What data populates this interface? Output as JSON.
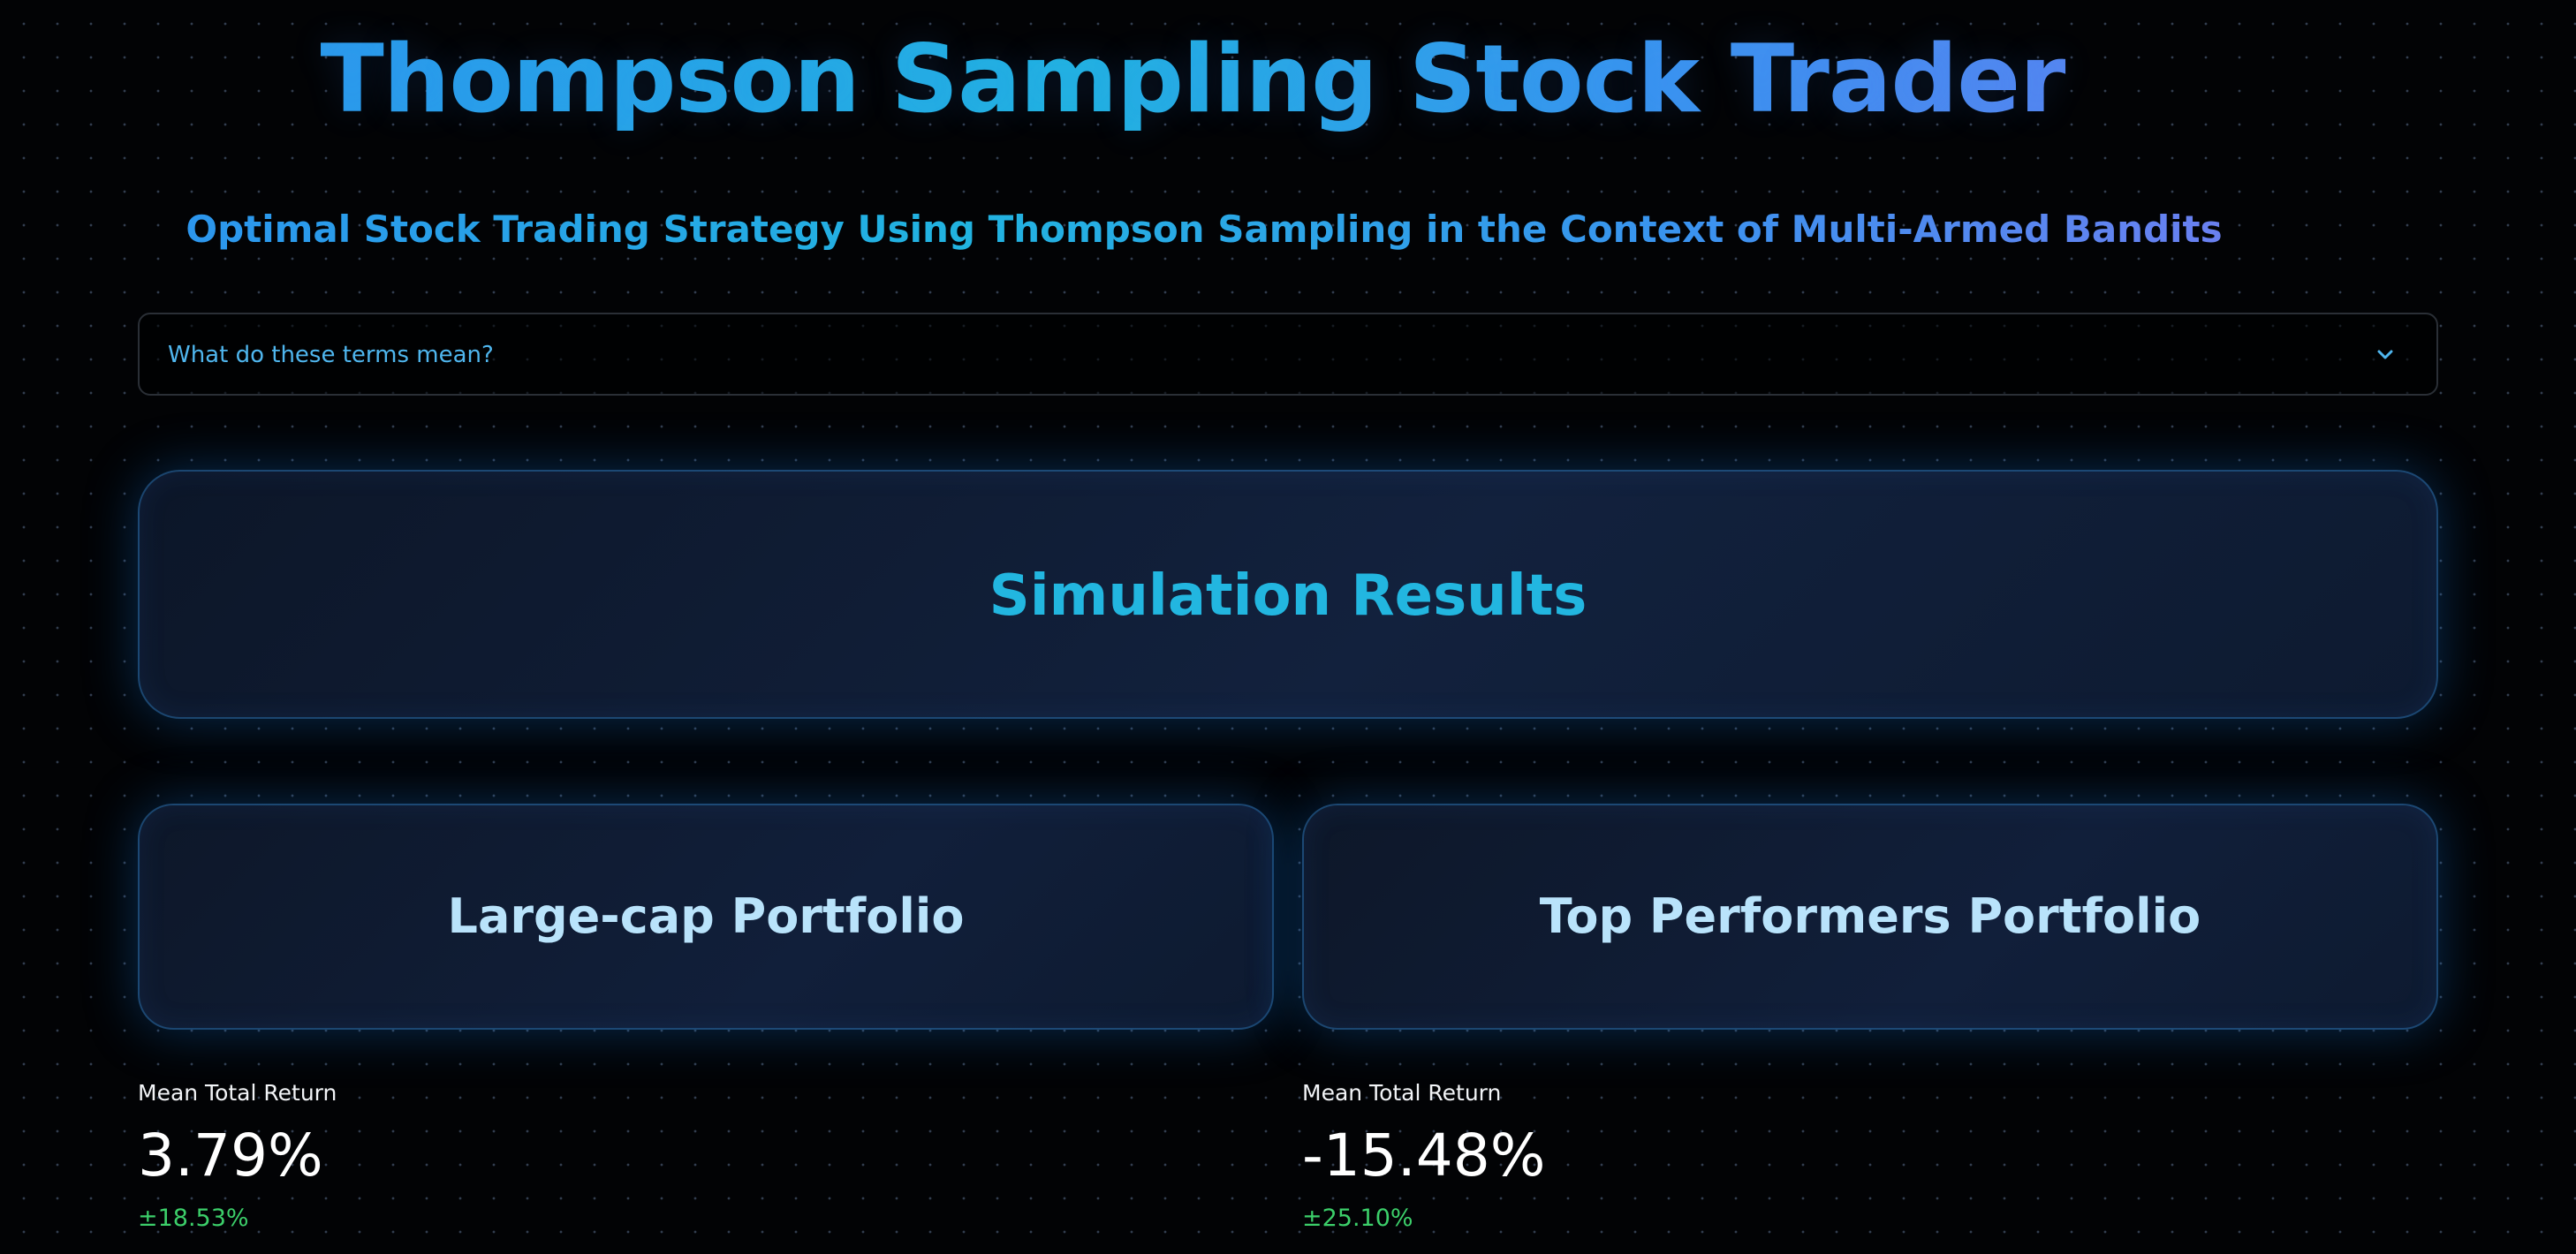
{
  "header": {
    "title": "Thompson Sampling Stock Trader",
    "subtitle": "Optimal Stock Trading Strategy Using Thompson Sampling in the Context of Multi-Armed Bandits"
  },
  "expander": {
    "label": "What do these terms mean?",
    "icon": "chevron-down-icon"
  },
  "simulation": {
    "title": "Simulation Results"
  },
  "portfolios": [
    {
      "title": "Large-cap Portfolio",
      "metric_label": "Mean Total Return",
      "metric_value": "3.79%",
      "metric_delta": "±18.53%"
    },
    {
      "title": "Top Performers Portfolio",
      "metric_label": "Mean Total Return",
      "metric_value": "-15.48%",
      "metric_delta": "±25.10%"
    }
  ],
  "colors": {
    "background": "#020305",
    "accent": "#22b6e0",
    "expander_text": "#4fb6ee",
    "portfolio_title": "#b9e3fb",
    "delta_positive": "#3ccf6a"
  }
}
